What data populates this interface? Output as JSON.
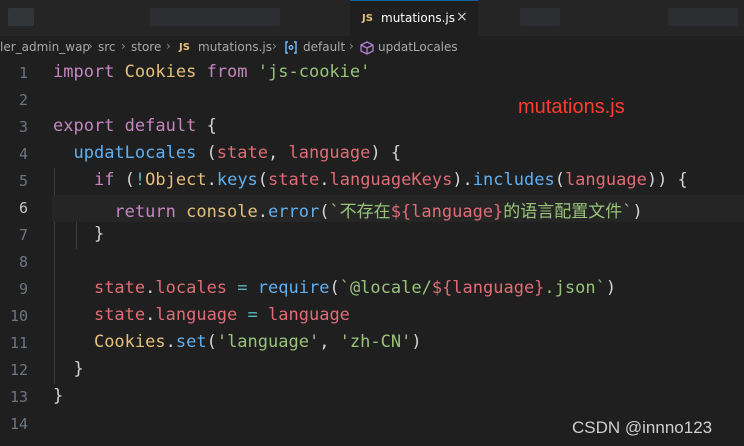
{
  "tab": {
    "badge": "JS",
    "label": "mutations.js",
    "close": "×"
  },
  "breadcrumb": {
    "segments": [
      "ler_admin_wap",
      "src",
      "store",
      "mutations.js",
      "default",
      "updatLocales"
    ],
    "badge": "JS",
    "separator": "›"
  },
  "annotation": "mutations.js",
  "watermark": "CSDN @innno123",
  "editor": {
    "active_line": 6,
    "lines": [
      {
        "n": "1",
        "tokens": [
          [
            "kw",
            "import"
          ],
          [
            "punc",
            " "
          ],
          [
            "id",
            "Cookies"
          ],
          [
            "punc",
            " "
          ],
          [
            "kw",
            "from"
          ],
          [
            "punc",
            " "
          ],
          [
            "str",
            "'js-cookie'"
          ]
        ]
      },
      {
        "n": "2",
        "tokens": []
      },
      {
        "n": "3",
        "tokens": [
          [
            "kw",
            "export"
          ],
          [
            "punc",
            " "
          ],
          [
            "kw",
            "default"
          ],
          [
            "punc",
            " {"
          ]
        ]
      },
      {
        "n": "4",
        "tokens": [
          [
            "punc",
            "  "
          ],
          [
            "fn",
            "updatLocales"
          ],
          [
            "punc",
            " ("
          ],
          [
            "var",
            "state"
          ],
          [
            "punc",
            ", "
          ],
          [
            "var",
            "language"
          ],
          [
            "punc",
            ") {"
          ]
        ]
      },
      {
        "n": "5",
        "tokens": [
          [
            "punc",
            "    "
          ],
          [
            "kw",
            "if"
          ],
          [
            "punc",
            " ("
          ],
          [
            "op",
            "!"
          ],
          [
            "id",
            "Object"
          ],
          [
            "punc",
            "."
          ],
          [
            "fn",
            "keys"
          ],
          [
            "punc",
            "("
          ],
          [
            "var",
            "state"
          ],
          [
            "punc",
            "."
          ],
          [
            "var",
            "languageKeys"
          ],
          [
            "punc",
            ")."
          ],
          [
            "fn",
            "includes"
          ],
          [
            "punc",
            "("
          ],
          [
            "var",
            "language"
          ],
          [
            "punc",
            ")) {"
          ]
        ]
      },
      {
        "n": "6",
        "tokens": [
          [
            "punc",
            "      "
          ],
          [
            "kw",
            "return"
          ],
          [
            "punc",
            " "
          ],
          [
            "id",
            "console"
          ],
          [
            "punc",
            "."
          ],
          [
            "fn",
            "error"
          ],
          [
            "punc",
            "("
          ],
          [
            "str",
            "`不存在"
          ],
          [
            "var",
            "${language}"
          ],
          [
            "str",
            "的语言配置文件`"
          ],
          [
            "punc",
            ")"
          ]
        ]
      },
      {
        "n": "7",
        "tokens": [
          [
            "punc",
            "    }"
          ]
        ]
      },
      {
        "n": "8",
        "tokens": []
      },
      {
        "n": "9",
        "tokens": [
          [
            "punc",
            "    "
          ],
          [
            "var",
            "state"
          ],
          [
            "punc",
            "."
          ],
          [
            "var",
            "locales"
          ],
          [
            "punc",
            " "
          ],
          [
            "op",
            "="
          ],
          [
            "punc",
            " "
          ],
          [
            "fn",
            "require"
          ],
          [
            "punc",
            "("
          ],
          [
            "str",
            "`@locale/"
          ],
          [
            "var",
            "${language}"
          ],
          [
            "str",
            ".json`"
          ],
          [
            "punc",
            ")"
          ]
        ]
      },
      {
        "n": "10",
        "tokens": [
          [
            "punc",
            "    "
          ],
          [
            "var",
            "state"
          ],
          [
            "punc",
            "."
          ],
          [
            "var",
            "language"
          ],
          [
            "punc",
            " "
          ],
          [
            "op",
            "="
          ],
          [
            "punc",
            " "
          ],
          [
            "var",
            "language"
          ]
        ]
      },
      {
        "n": "11",
        "tokens": [
          [
            "punc",
            "    "
          ],
          [
            "id",
            "Cookies"
          ],
          [
            "punc",
            "."
          ],
          [
            "fn",
            "set"
          ],
          [
            "punc",
            "("
          ],
          [
            "str",
            "'language'"
          ],
          [
            "punc",
            ", "
          ],
          [
            "str",
            "'zh-CN'"
          ],
          [
            "punc",
            ")"
          ]
        ]
      },
      {
        "n": "12",
        "tokens": [
          [
            "punc",
            "  }"
          ]
        ]
      },
      {
        "n": "13",
        "tokens": [
          [
            "punc",
            "}"
          ]
        ]
      },
      {
        "n": "14",
        "tokens": []
      }
    ]
  }
}
